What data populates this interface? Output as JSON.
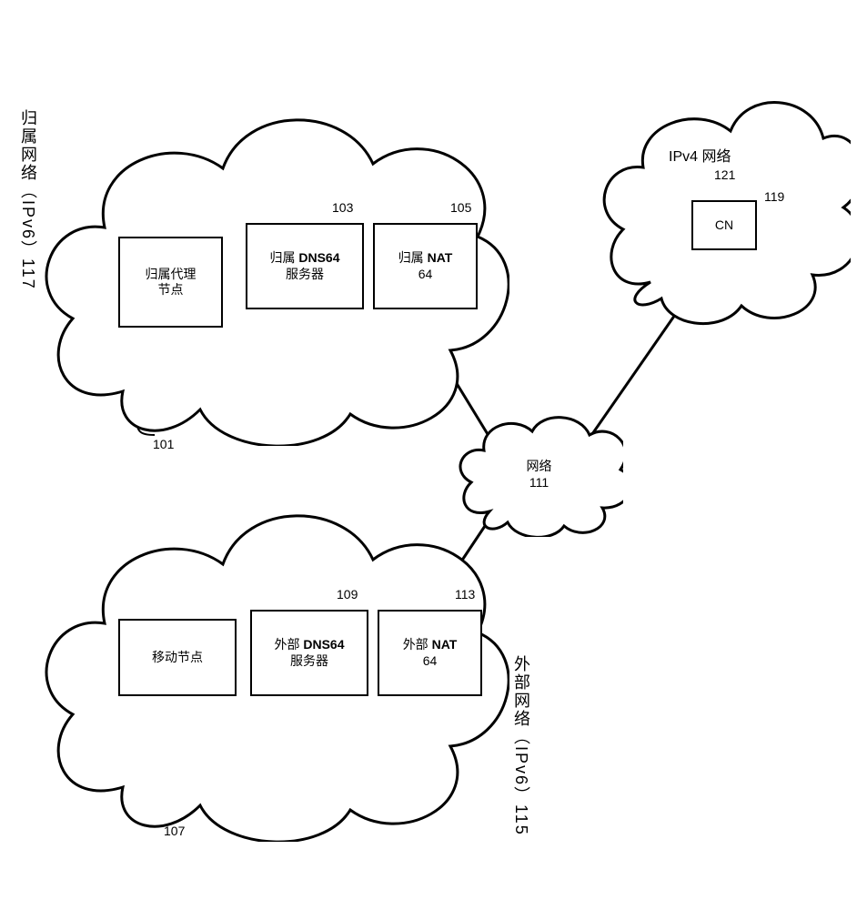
{
  "home": {
    "title": "归属网络（IPv6）117",
    "agent": {
      "label": "归属代理\n节点",
      "num": "101"
    },
    "dns": {
      "l1": "归属 ",
      "b": "DNS64",
      "l2": "服务器",
      "num": "103"
    },
    "nat": {
      "l1": "归属 ",
      "b": "NAT",
      "l2": "64",
      "num": "105"
    }
  },
  "foreign": {
    "title": "外部网络（IPv6）115",
    "mn": {
      "label": "移动节点",
      "num": "107"
    },
    "dns": {
      "l1": "外部 ",
      "b": "DNS64",
      "l2": "服务器",
      "num": "109"
    },
    "nat": {
      "l1": "外部 ",
      "b": "NAT",
      "l2": "64",
      "num": "113"
    }
  },
  "core": {
    "label": "网络",
    "num": "111"
  },
  "ipv4": {
    "title": "IPv4 网络",
    "num": "121",
    "cn": {
      "label": "CN",
      "num": "119"
    }
  }
}
